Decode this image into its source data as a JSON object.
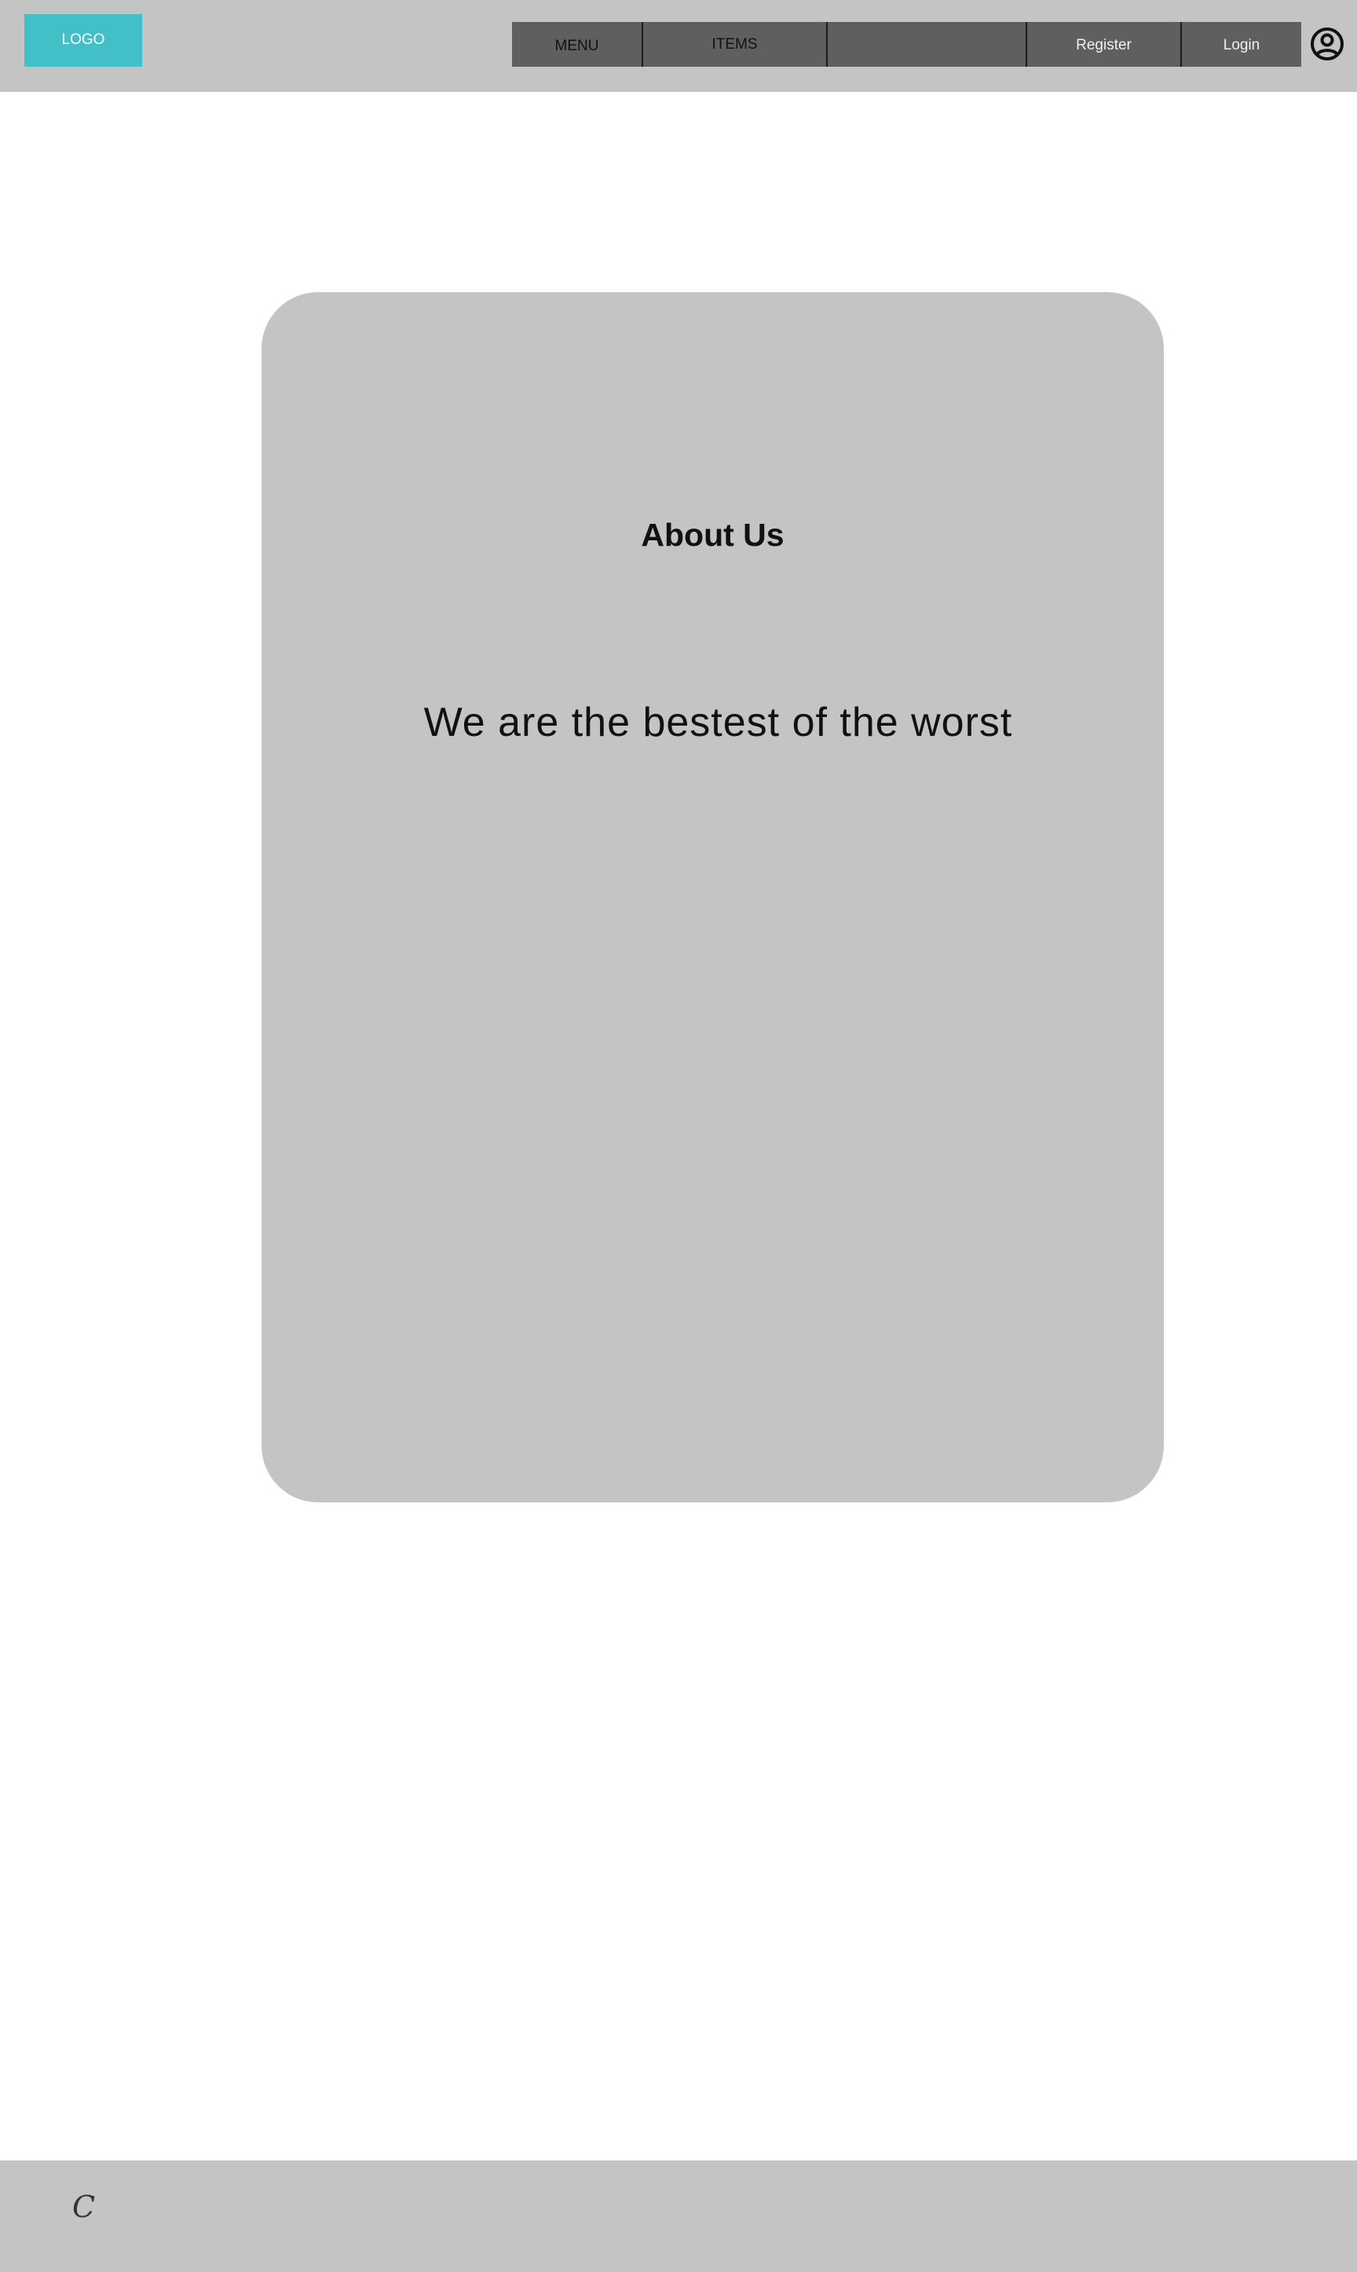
{
  "header": {
    "logo_label": "LOGO",
    "nav": {
      "menu": "MENU",
      "items": "ITEMS",
      "blank": "",
      "register": "Register",
      "login": "Login"
    },
    "account_icon": "account-circle-icon"
  },
  "main": {
    "title": "About Us",
    "text": "We are the bestest of the worst"
  },
  "footer": {
    "mark": "C"
  },
  "colors": {
    "header_bg": "#c4c4c4",
    "logo_bg": "#43bfc7",
    "nav_bg": "#5f5f5f",
    "card_bg": "#c4c4c4",
    "page_bg": "#ffffff"
  }
}
